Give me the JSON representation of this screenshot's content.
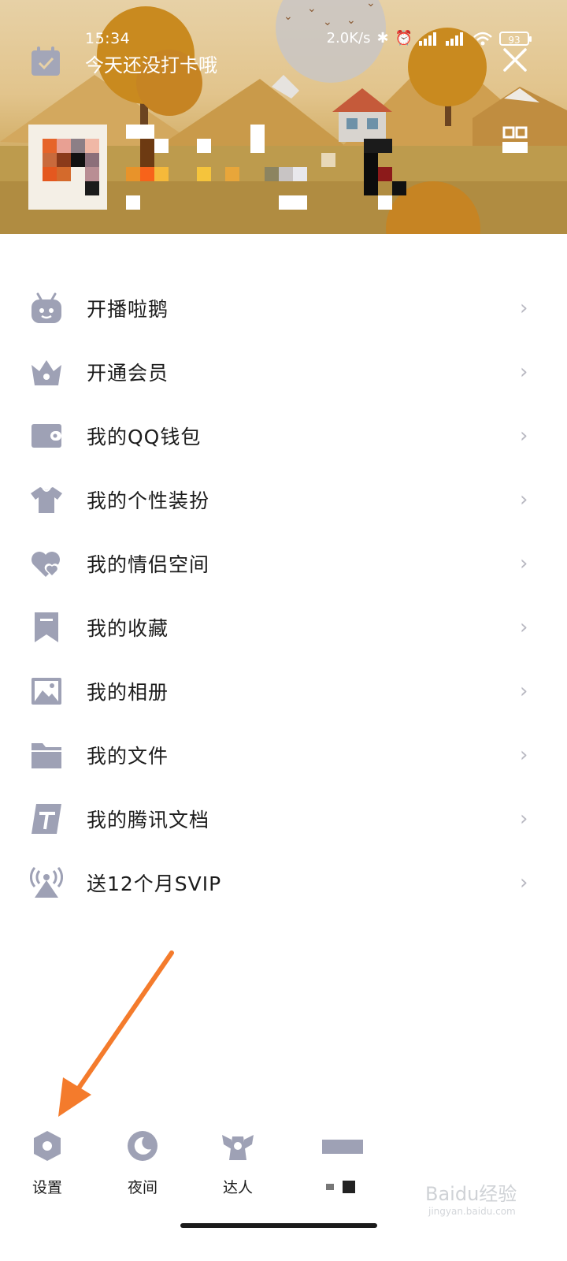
{
  "status_bar": {
    "time": "15:34",
    "net_speed": "2.0K/s",
    "battery": "93"
  },
  "header": {
    "checkin_text": "今天还没打卡哦"
  },
  "menu": {
    "items": [
      {
        "label": "开播啦鹅",
        "icon": "tv-robot-icon"
      },
      {
        "label": "开通会员",
        "icon": "crown-icon"
      },
      {
        "label": "我的QQ钱包",
        "icon": "wallet-icon"
      },
      {
        "label": "我的个性装扮",
        "icon": "shirt-icon"
      },
      {
        "label": "我的情侣空间",
        "icon": "hearts-icon"
      },
      {
        "label": "我的收藏",
        "icon": "bookmark-icon"
      },
      {
        "label": "我的相册",
        "icon": "photo-icon"
      },
      {
        "label": "我的文件",
        "icon": "folder-icon"
      },
      {
        "label": "我的腾讯文档",
        "icon": "doc-icon"
      },
      {
        "label": "送12个月SVIP",
        "icon": "broadcast-icon"
      }
    ],
    "chevron": "›"
  },
  "bottom_tabs": {
    "settings": "设置",
    "night": "夜间",
    "talent": "达人"
  },
  "watermark": {
    "brand": "Baidu经验",
    "url": "jingyan.baidu.com"
  },
  "colors": {
    "icon_gray": "#9ea1b5",
    "arrow_orange": "#f47b2c"
  }
}
